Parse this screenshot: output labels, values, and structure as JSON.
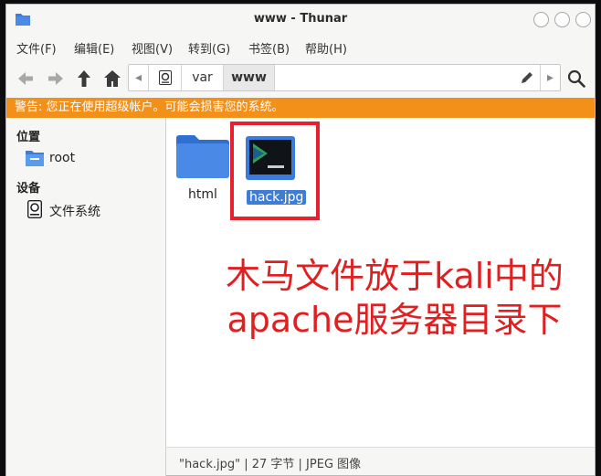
{
  "window": {
    "title": "www - Thunar"
  },
  "menu": [
    "文件(F)",
    "编辑(E)",
    "视图(V)",
    "转到(G)",
    "书签(B)",
    "帮助(H)"
  ],
  "pathbar": {
    "segments": [
      "var",
      "www"
    ]
  },
  "warning": "警告: 您正在使用超级帐户。可能会损害您的系统。",
  "sidebar": {
    "places_heading": "位置",
    "places": [
      {
        "label": "root",
        "icon": "folder-home-icon"
      }
    ],
    "devices_heading": "设备",
    "devices": [
      {
        "label": "文件系统",
        "icon": "drive-icon"
      }
    ]
  },
  "files": [
    {
      "name": "html",
      "icon": "folder-icon",
      "selected": false
    },
    {
      "name": "hack.jpg",
      "icon": "image-file-icon",
      "selected": true
    }
  ],
  "annotation": {
    "line1": "木马文件放于kali中的",
    "line2": "apache服务器目录下"
  },
  "status": "\"hack.jpg\" | 27 字节 | JPEG 图像",
  "colors": {
    "warning_bg": "#f39019",
    "selection": "#3d7dd8",
    "annotation_red": "#e81f2c"
  }
}
